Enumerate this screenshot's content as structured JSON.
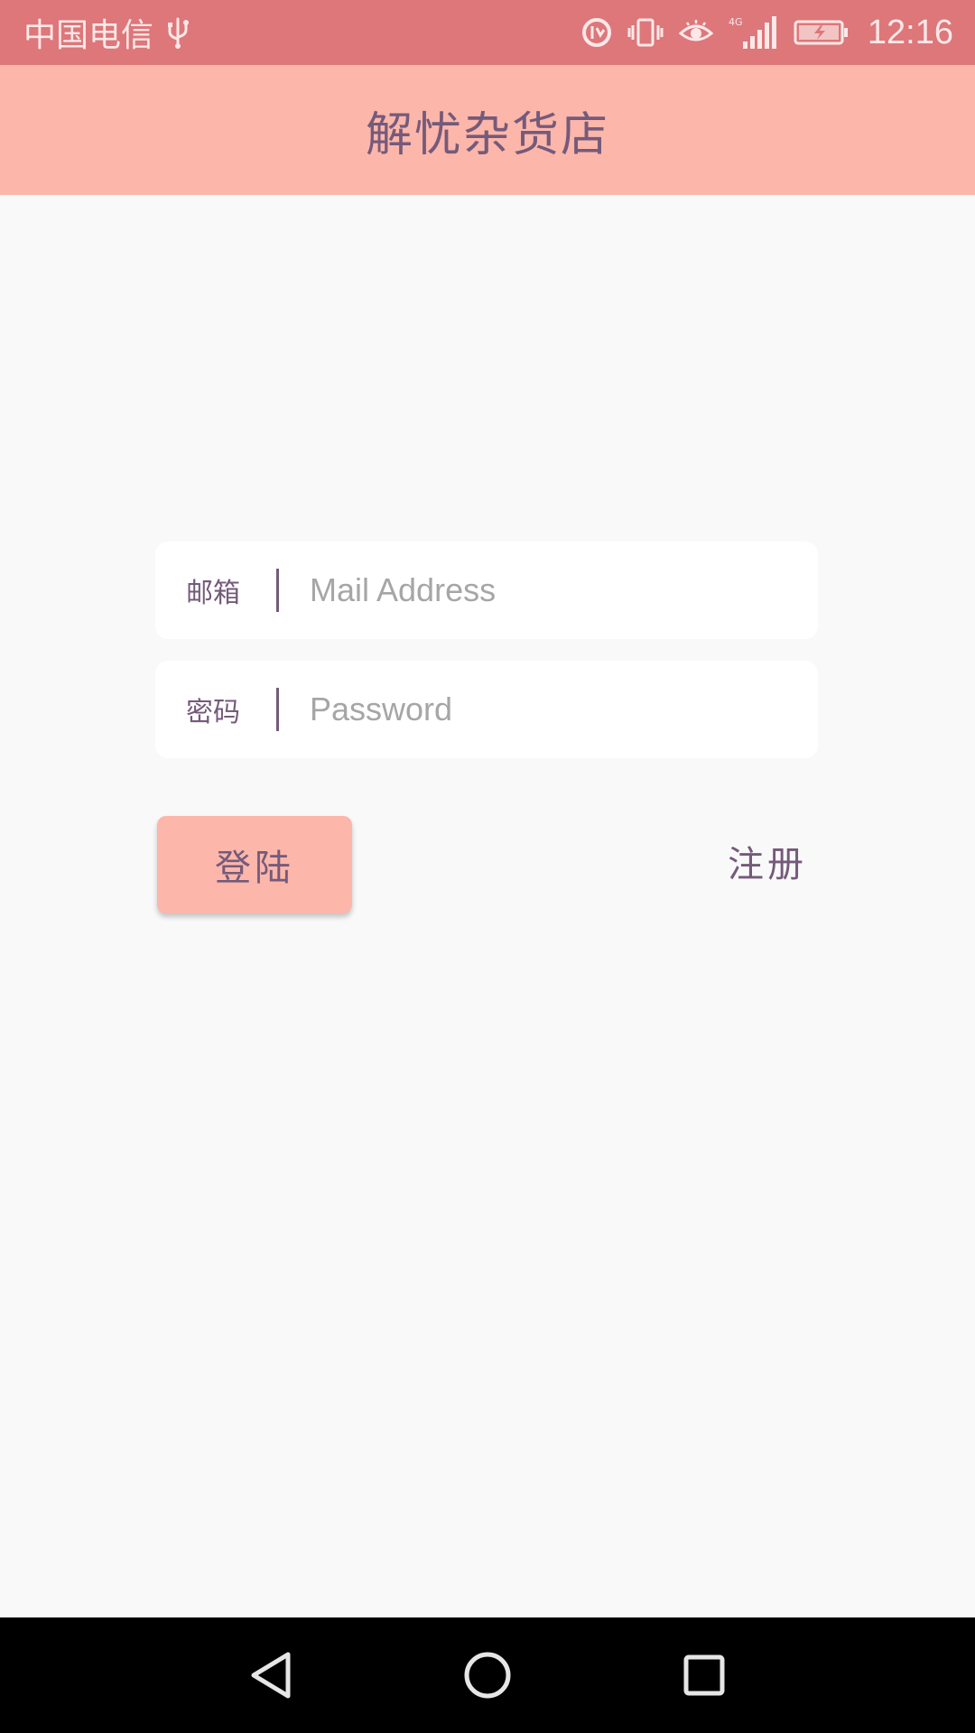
{
  "status_bar": {
    "carrier": "中国电信",
    "network": "4G",
    "time": "12:16",
    "icons": [
      "usb-icon",
      "data-saver-icon",
      "vibrate-icon",
      "eye-comfort-icon",
      "signal-icon",
      "battery-charging-icon"
    ]
  },
  "app_bar": {
    "title": "解忧杂货店"
  },
  "login_form": {
    "email": {
      "label": "邮箱",
      "placeholder": "Mail Address",
      "value": ""
    },
    "password": {
      "label": "密码",
      "placeholder": "Password",
      "value": ""
    },
    "login_label": "登陆",
    "register_label": "注册"
  },
  "nav_bar": {
    "icons": [
      "back-icon",
      "home-icon",
      "recents-icon"
    ]
  },
  "colors": {
    "status_bar": "#dd777a",
    "app_bar": "#fcb6aa",
    "accent_text": "#755a7a",
    "background": "#f9f9fa"
  }
}
